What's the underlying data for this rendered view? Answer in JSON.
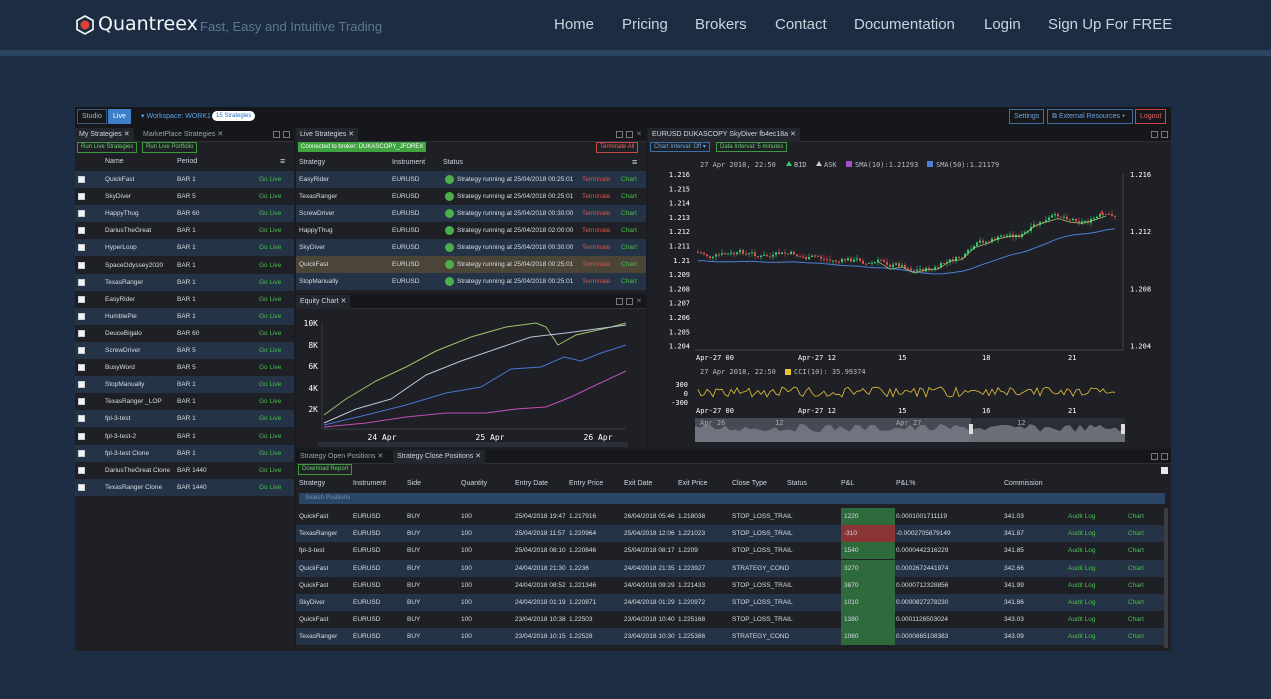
{
  "site": {
    "brand": "Quantreex",
    "tagline": "Fast, Easy and Intuitive Trading",
    "nav": [
      "Home",
      "Pricing",
      "Brokers",
      "Contact",
      "Documentation",
      "Login",
      "Sign Up For FREE"
    ]
  },
  "toolbar": {
    "studio": "Studio",
    "live": "Live",
    "workspace": "▾ Workspace: WORK1",
    "strategies_badge": "15 Strategies",
    "settings": "Settings",
    "external": "External Resources ▾",
    "logout": "Logout"
  },
  "my_strategies": {
    "tab1": "My Strategies",
    "tab2": "MarketPlace Strategies",
    "btn_run": "Run Live Strategies",
    "btn_portfolio": "Run Live Portfolio",
    "col_name": "Name",
    "col_period": "Period",
    "action": "Go Live",
    "rows": [
      [
        "QuickFast",
        "BAR 1"
      ],
      [
        "SkyDiver",
        "BAR 5"
      ],
      [
        "HappyThug",
        "BAR 60"
      ],
      [
        "DariusTheGreat",
        "BAR 1"
      ],
      [
        "HyperLoop",
        "BAR 1"
      ],
      [
        "SpaceOdyssey2020",
        "BAR 1"
      ],
      [
        "TexasRanger",
        "BAR 1"
      ],
      [
        "EasyRider",
        "BAR 1"
      ],
      [
        "HumblePie",
        "BAR 1"
      ],
      [
        "DeuceBigalo",
        "BAR 60"
      ],
      [
        "ScrewDriver",
        "BAR 5"
      ],
      [
        "BusyWord",
        "BAR 5"
      ],
      [
        "StopManually",
        "BAR 1"
      ],
      [
        "TexasRanger _LOP",
        "BAR 1"
      ],
      [
        "fpl-3-test",
        "BAR 1"
      ],
      [
        "fpl-3-test-2",
        "BAR 1"
      ],
      [
        "fpl-3-test Clone",
        "BAR 1"
      ],
      [
        "DariusTheGreat Clone",
        "BAR 1440"
      ],
      [
        "TexasRanger Clone",
        "BAR 1440"
      ]
    ]
  },
  "live_strategies": {
    "tab": "Live Strategies",
    "connected": "Connected to broker: DUKASCOPY_JFOREX",
    "terminate_all": "Terminate All",
    "col_strategy": "Strategy",
    "col_instrument": "Instrument",
    "col_status": "Status",
    "terminate": "Terminate",
    "chart": "Chart",
    "rows": [
      [
        "EasyRider",
        "EURUSD",
        "Strategy running at 25/04/2018 00:25:01"
      ],
      [
        "TexasRanger",
        "EURUSD",
        "Strategy running at 25/04/2018 00:25:01"
      ],
      [
        "ScrewDriver",
        "EURUSD",
        "Strategy running at 25/04/2018 00:30:00"
      ],
      [
        "HappyThug",
        "EURUSD",
        "Strategy running at 25/04/2018 02:00:00"
      ],
      [
        "SkyDiver",
        "EURUSD",
        "Strategy running at 25/04/2018 00:30:00"
      ],
      [
        "QuickFast",
        "EURUSD",
        "Strategy running at 25/04/2018 00:25:01"
      ],
      [
        "StopManually",
        "EURUSD",
        "Strategy running at 25/04/2018 00:25:01"
      ]
    ]
  },
  "equity": {
    "tab": "Equity Chart",
    "yticks": [
      "10K",
      "8K",
      "6K",
      "4K",
      "2K"
    ],
    "xticks": [
      "24 Apr",
      "25 Apr",
      "26 Apr"
    ]
  },
  "price": {
    "tab": "EURUSD DUKASCOPY SkyDiver fb4ec18a",
    "btn_interval": "Chart Interval: Off ▾",
    "btn_data": "Data Interval: 5 minutes",
    "legend_time": "27 Apr 2018, 22:50",
    "bid": "BID",
    "ask": "ASK",
    "sma10": "SMA(10):1.21293",
    "sma50": "SMA(50):1.21179",
    "left_ticks": [
      "1.216",
      "1.215",
      "1.214",
      "1.213",
      "1.212",
      "1.211",
      "1.21",
      "1.209",
      "1.208",
      "1.207",
      "1.206",
      "1.205",
      "1.204"
    ],
    "right_ticks": [
      "1.216",
      "1.212",
      "1.208",
      "1.204"
    ],
    "xticks": [
      "Apr-27 00",
      "Apr-27 12",
      "15",
      "18",
      "21"
    ],
    "cci_time": "27 Apr 2018, 22:50",
    "cci": "CCI(10): 35.99374",
    "cci_ticks": [
      "300",
      "0",
      "-300"
    ],
    "cci_xticks": [
      "Apr-27 00",
      "Apr-27 12",
      "15",
      "16",
      "21"
    ],
    "nav_ticks": [
      "Apr 26",
      "12",
      "Apr 27",
      "12"
    ],
    "colors": {
      "bid": "#2ecc71",
      "ask": "#cccccc",
      "sma10": "#a64dcc",
      "sma50": "#4d7fd9"
    }
  },
  "positions": {
    "tab1": "Strategy Open Positions",
    "tab2": "Strategy Close Positions",
    "download": "Download Report",
    "search": "Search Positions",
    "cols": [
      "Strategy",
      "Instrument",
      "Side",
      "Quantity",
      "Entry Date",
      "Entry Price",
      "Exit Date",
      "Exit Price",
      "Close Type",
      "Status",
      "P&L",
      "P&L%",
      "Commission"
    ],
    "audit": "Audit Log",
    "chart": "Chart",
    "rows": [
      [
        "QuickFast",
        "EURUSD",
        "BUY",
        "100",
        "25/04/2018 19:47",
        "1.217916",
        "26/04/2018 05:46",
        "1.218038",
        "STOP_LOSS_TRAIL",
        "",
        "1220",
        "0.0001001711119",
        "341.03"
      ],
      [
        "TexasRanger",
        "EURUSD",
        "BUY",
        "100",
        "25/04/2018 11:57",
        "1.220964",
        "25/04/2018 12:06",
        "1.221023",
        "STOP_LOSS_TRAIL",
        "",
        "-310",
        "-0.0002705879149",
        "341.87"
      ],
      [
        "fpl-3-test",
        "EURUSD",
        "BUY",
        "100",
        "25/04/2018 08:10",
        "1.220846",
        "25/04/2018 08:17",
        "1.2209",
        "STOP_LOSS_TRAIL",
        "",
        "1540",
        "0.0000442316229",
        "341.85"
      ],
      [
        "QuickFast",
        "EURUSD",
        "BUY",
        "100",
        "24/04/2018 21:30",
        "1.2236",
        "24/04/2018 21:35",
        "1.223927",
        "STRATEGY_COND",
        "",
        "3270",
        "0.0002672441974",
        "342.66"
      ],
      [
        "QuickFast",
        "EURUSD",
        "BUY",
        "100",
        "24/04/2018 08:52",
        "1.221346",
        "24/04/2018 09:29",
        "1.221433",
        "STOP_LOSS_TRAIL",
        "",
        "3870",
        "0.0000712328856",
        "341.99"
      ],
      [
        "SkyDiver",
        "EURUSD",
        "BUY",
        "100",
        "24/04/2018 01:19",
        "1.220871",
        "24/04/2018 01:29",
        "1.220972",
        "STOP_LOSS_TRAIL",
        "",
        "1010",
        "0.0000827278230",
        "341.86"
      ],
      [
        "QuickFast",
        "EURUSD",
        "BUY",
        "100",
        "23/04/2018 10:38",
        "1.22503",
        "23/04/2018 10:40",
        "1.225168",
        "STOP_LOSS_TRAIL",
        "",
        "1380",
        "0.0001126503024",
        "343.03"
      ],
      [
        "TexasRanger",
        "EURUSD",
        "BUY",
        "100",
        "23/04/2018 10:15",
        "1.22528",
        "23/04/2018 10:30",
        "1.225386",
        "STRATEGY_COND",
        "",
        "1060",
        "0.0000865108383",
        "343.09"
      ]
    ]
  }
}
